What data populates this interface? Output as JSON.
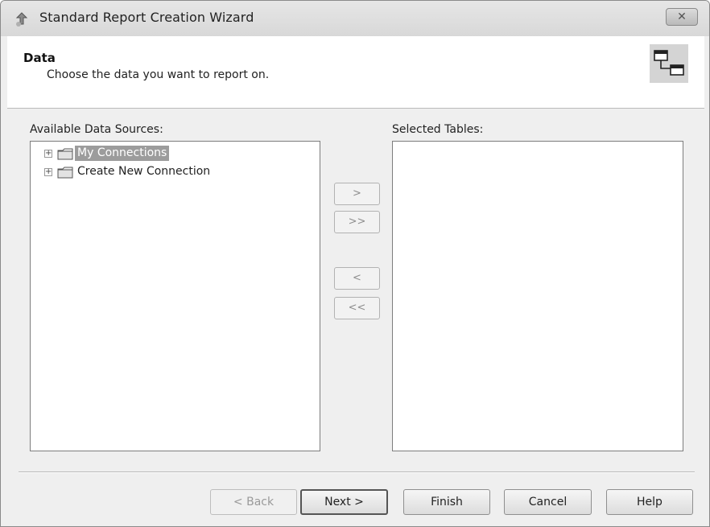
{
  "window": {
    "title": "Standard Report Creation Wizard",
    "close_label": "✕"
  },
  "header": {
    "title": "Data",
    "subtitle": "Choose the data you want to report on."
  },
  "available": {
    "label": "Available Data Sources:",
    "items": [
      {
        "label": "My Connections",
        "selected": true
      },
      {
        "label": "Create New Connection",
        "selected": false
      }
    ]
  },
  "selected": {
    "label": "Selected Tables:"
  },
  "movers": {
    "add": ">",
    "add_all": ">>",
    "remove": "<",
    "remove_all": "<<"
  },
  "buttons": {
    "back": "< Back",
    "next": "Next >",
    "finish": "Finish",
    "cancel": "Cancel",
    "help": "Help"
  },
  "icons": {
    "title": "wizard-icon",
    "header": "linked-tables-icon",
    "tree_expand": "plus-expander-icon",
    "folder": "folder-icon"
  },
  "colors": {
    "selection": "#9c9c9c",
    "window_bg": "#efefef"
  }
}
